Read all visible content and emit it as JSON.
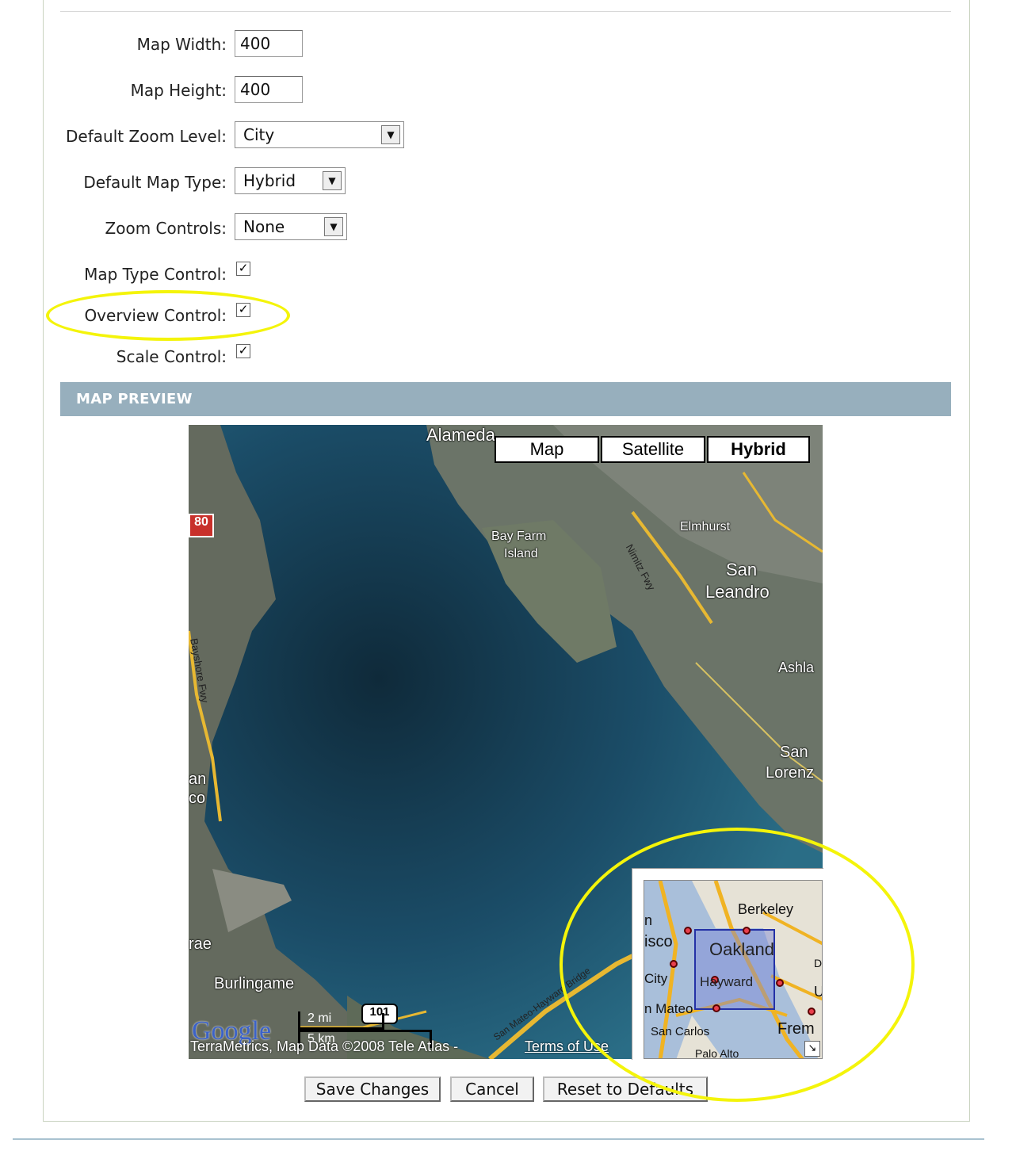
{
  "form": {
    "map_width_label": "Map Width:",
    "map_width_value": "400",
    "map_height_label": "Map Height:",
    "map_height_value": "400",
    "zoom_level_label": "Default Zoom Level:",
    "zoom_level_value": "City",
    "map_type_label": "Default Map Type:",
    "map_type_value": "Hybrid",
    "zoom_controls_label": "Zoom Controls:",
    "zoom_controls_value": "None",
    "map_type_control_label": "Map Type Control:",
    "map_type_control_checked": true,
    "overview_control_label": "Overview Control:",
    "overview_control_checked": true,
    "scale_control_label": "Scale Control:",
    "scale_control_checked": true
  },
  "section": {
    "title": "MAP PREVIEW"
  },
  "map": {
    "type_buttons": [
      "Map",
      "Satellite",
      "Hybrid"
    ],
    "active_type": "Hybrid",
    "labels": {
      "alameda": "Alameda",
      "bay_farm": "Bay Farm",
      "island": "Island",
      "elmhurst": "Elmhurst",
      "san": "San",
      "leandro": "Leandro",
      "ashland": "Ashla",
      "san2": "San",
      "lorenzo": "Lorenz",
      "nimitz": "Nimitz Fwy",
      "bayshore": "Bayshore Fwy",
      "san_mateo_bridge": "San Mateo-Hayward Bridge",
      "burlingame": "Burlingame",
      "rae": "rae",
      "an": "an",
      "co": "co",
      "i880": "80",
      "us101": "101"
    },
    "scale": {
      "miles": "2 mi",
      "km": "5 km"
    },
    "attribution": "TerraMetrics, Map Data ©2008 Tele Atlas -",
    "terms": "Terms of Use",
    "google_logo": "Google",
    "overview": {
      "berkeley": "Berkeley",
      "oakland": "Oakland",
      "hayward": "Hayward",
      "isco": "isco",
      "n": "n",
      "city": "City",
      "n_mateo": "n Mateo",
      "san_carlos": "San Carlos",
      "palo_alto": "Palo Alto",
      "frem": "Frem",
      "u": "U",
      "d": "D",
      "corner": "↘"
    }
  },
  "buttons": {
    "save": "Save Changes",
    "cancel": "Cancel",
    "reset": "Reset to Defaults"
  },
  "colors": {
    "section_bar": "#97afbd",
    "highlight_circle": "#f4f40a"
  }
}
